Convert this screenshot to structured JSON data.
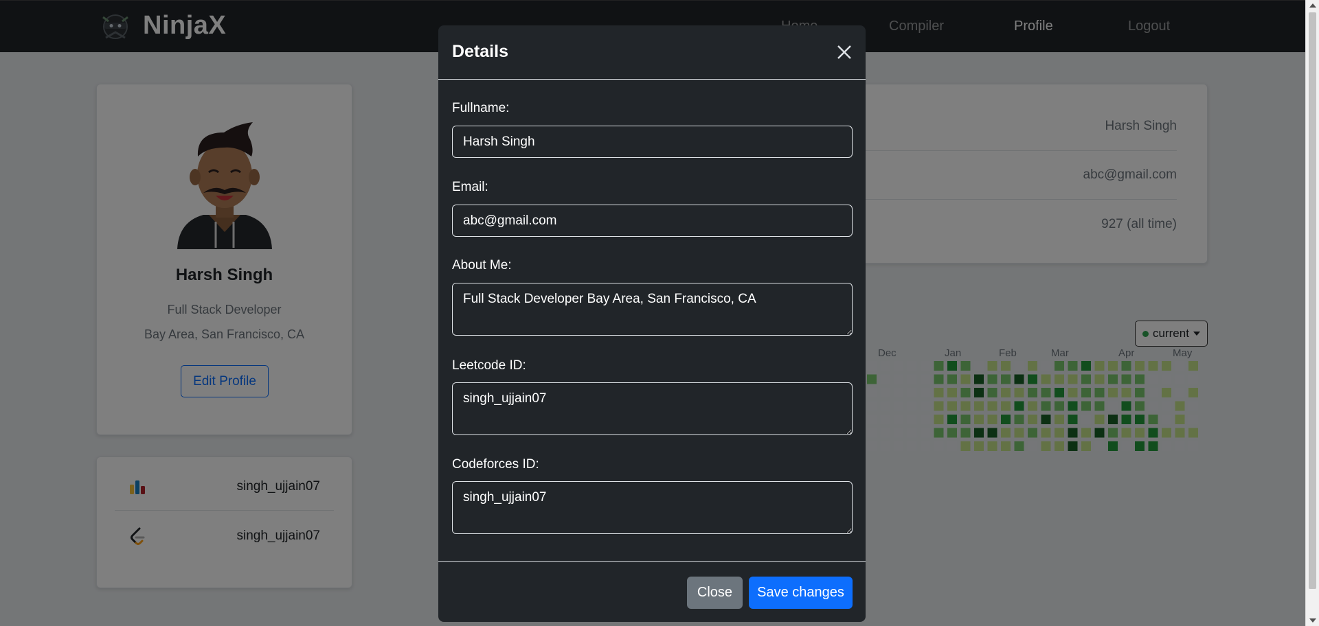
{
  "navbar": {
    "brand": "NinjaX",
    "links": [
      {
        "label": "Home",
        "active": false
      },
      {
        "label": "Compiler",
        "active": false
      },
      {
        "label": "Profile",
        "active": true
      },
      {
        "label": "Logout",
        "active": false
      }
    ]
  },
  "profile": {
    "name": "Harsh Singh",
    "role": "Full Stack Developer",
    "location": "Bay Area, San Francisco, CA",
    "edit_button": "Edit Profile"
  },
  "platform_ids": [
    {
      "icon": "codeforces-icon",
      "value": "singh_ujjain07"
    },
    {
      "icon": "leetcode-icon",
      "value": "singh_ujjain07"
    }
  ],
  "info": {
    "fullname": "Harsh Singh",
    "email": "abc@gmail.com",
    "solved": "927 (all time)"
  },
  "activity": {
    "selector_label": "current",
    "months": [
      "Dec",
      "Jan",
      "Feb",
      "Mar",
      "Apr",
      "May"
    ],
    "colors": [
      "#ebedf0",
      "#c6e48b",
      "#7bc96f",
      "#239a3b",
      "#196127"
    ]
  },
  "modal": {
    "title": "Details",
    "fields": {
      "fullname": {
        "label": "Fullname:",
        "value": "Harsh Singh"
      },
      "email": {
        "label": "Email:",
        "value": "abc@gmail.com"
      },
      "about": {
        "label": "About Me:",
        "value": "Full Stack Developer Bay Area, San Francisco, CA"
      },
      "leetcode": {
        "label": "Leetcode ID:",
        "value": "singh_ujjain07"
      },
      "codeforces": {
        "label": "Codeforces ID:",
        "value": "singh_ujjain07"
      }
    },
    "close_label": "Close",
    "save_label": "Save changes"
  }
}
